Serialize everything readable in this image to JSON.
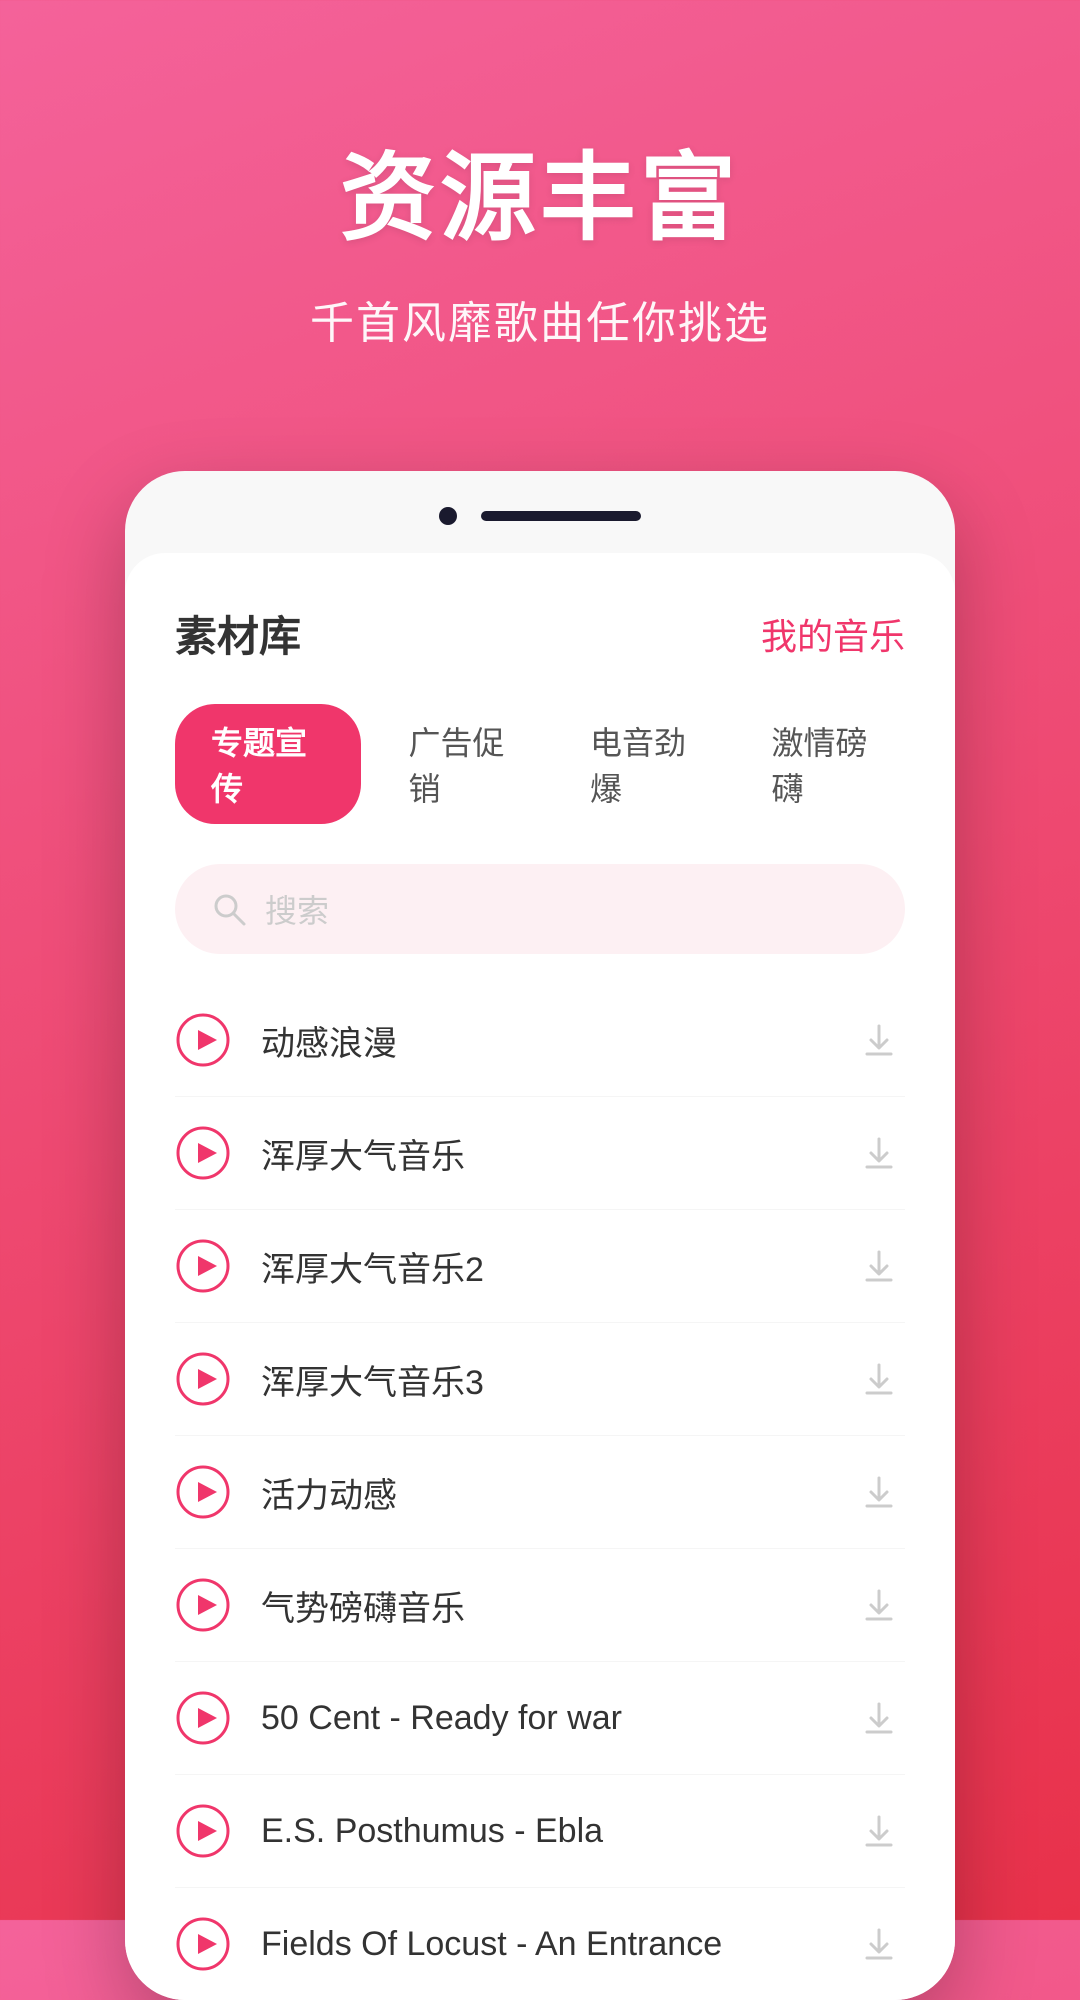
{
  "hero": {
    "title": "资源丰富",
    "subtitle": "千首风靡歌曲任你挑选"
  },
  "app": {
    "library_title": "素材库",
    "my_music_label": "我的音乐",
    "tabs": [
      {
        "label": "专题宣传",
        "active": true
      },
      {
        "label": "广告促销",
        "active": false
      },
      {
        "label": "电音劲爆",
        "active": false
      },
      {
        "label": "激情磅礴",
        "active": false
      }
    ],
    "search": {
      "placeholder": "搜索"
    },
    "music_items": [
      {
        "name": "动感浪漫"
      },
      {
        "name": "浑厚大气音乐"
      },
      {
        "name": "浑厚大气音乐2"
      },
      {
        "name": "浑厚大气音乐3"
      },
      {
        "name": "活力动感"
      },
      {
        "name": "气势磅礴音乐"
      },
      {
        "name": "50 Cent - Ready for war"
      },
      {
        "name": "E.S. Posthumus - Ebla"
      },
      {
        "name": "Fields Of Locust - An Entrance"
      }
    ]
  }
}
